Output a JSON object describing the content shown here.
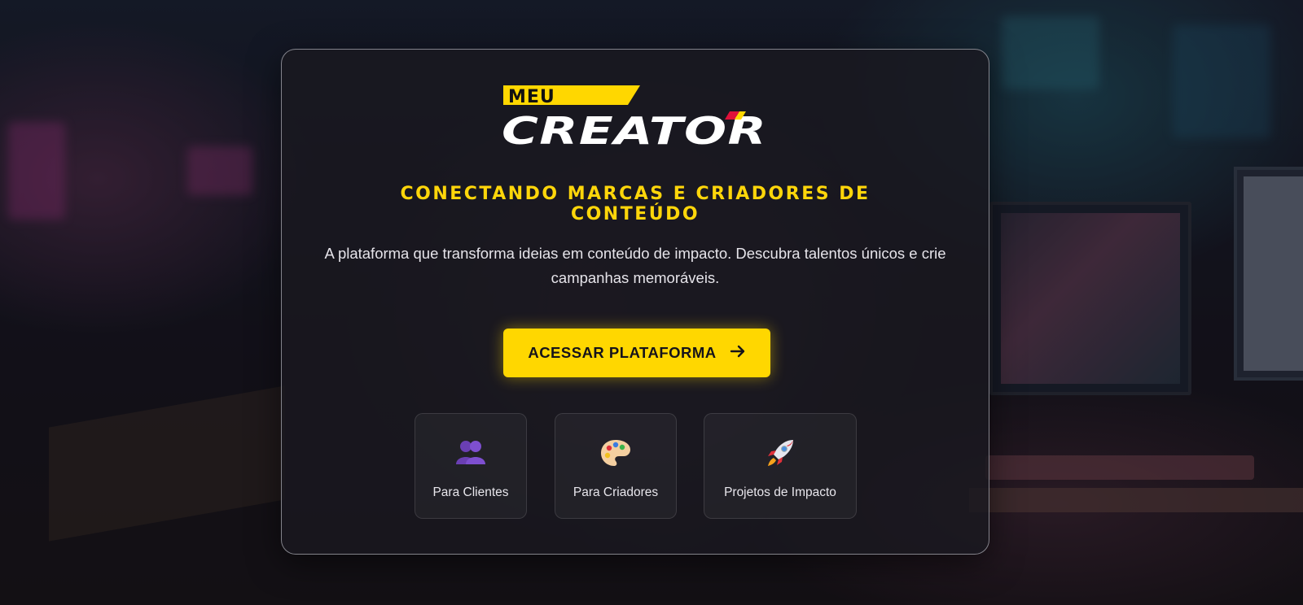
{
  "brand": {
    "logo_top": "MEU",
    "logo_main": "CREATOR",
    "colors": {
      "accent": "#FFD700",
      "logo_stripe_red": "#E0103A"
    }
  },
  "hero": {
    "headline": "CONECTANDO MARCAS E CRIADORES DE CONTEÚDO",
    "description": "A plataforma que transforma ideias em conteúdo de impacto. Descubra talentos únicos e crie campanhas memoráveis.",
    "cta_label": "ACESSAR PLATAFORMA",
    "cta_icon": "arrow-right-icon"
  },
  "features": [
    {
      "label": "Para Clientes",
      "icon": "people-icon"
    },
    {
      "label": "Para Criadores",
      "icon": "palette-icon"
    },
    {
      "label": "Projetos de Impacto",
      "icon": "rocket-icon"
    }
  ]
}
